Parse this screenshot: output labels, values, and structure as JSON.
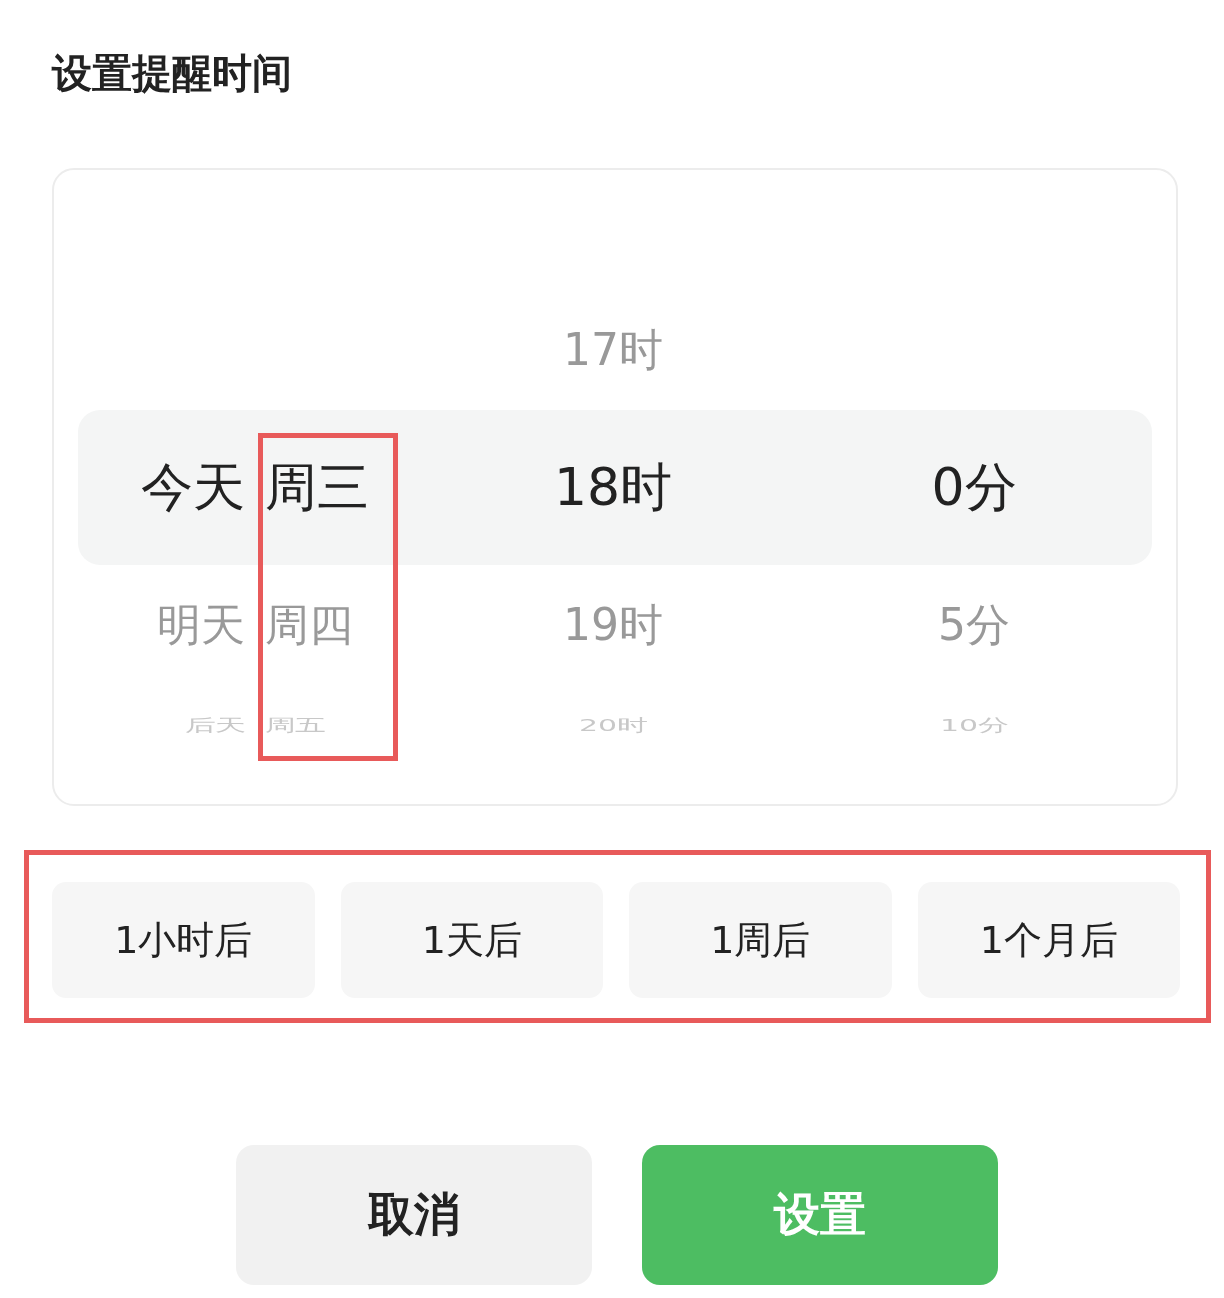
{
  "title": "设置提醒时间",
  "picker": {
    "rows": [
      {
        "kind": "near",
        "hour": "17时"
      },
      {
        "kind": "center",
        "day": "今天",
        "weekday": "周三",
        "hour": "18时",
        "minute": "0分"
      },
      {
        "kind": "near",
        "day": "明天",
        "weekday": "周四",
        "hour": "19时",
        "minute": "5分"
      },
      {
        "kind": "far",
        "day": "后天",
        "weekday": "周五",
        "hour": "20时",
        "minute": "10分"
      }
    ]
  },
  "quick_options": [
    "1小时后",
    "1天后",
    "1周后",
    "1个月后"
  ],
  "buttons": {
    "cancel": "取消",
    "confirm": "设置"
  }
}
